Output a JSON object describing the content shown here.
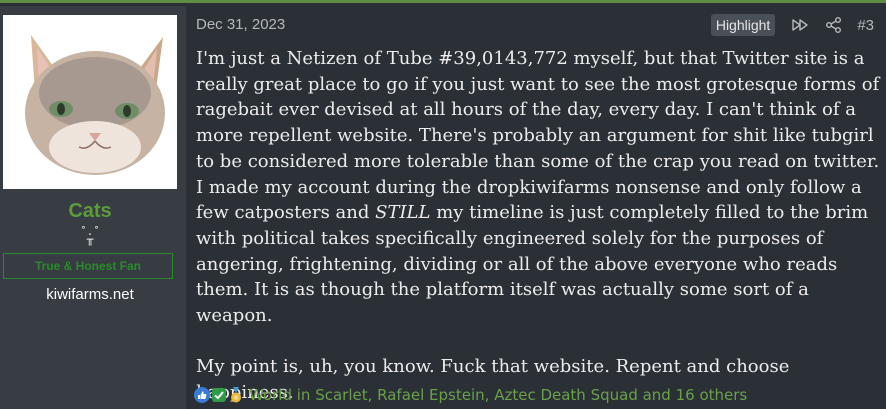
{
  "user": {
    "username": "Cats",
    "title": "˚.˚\n╥",
    "banner": "True & Honest Fan",
    "site": "kiwifarms.net"
  },
  "post": {
    "date": "Dec 31, 2023",
    "highlight_label": "Highlight",
    "number": "#3",
    "para1_a": "I'm just a Netizen of Tube #39,0143,772 myself, but that Twitter site is a really great place to go if you just want to see the most grotesque forms of ragebait ever devised at all hours of the day, every day. I can't think of a more repellent website. There's probably an argument for shit like tubgirl to be considered more tolerable than some of the crap you read on twitter. I made my account during the dropkiwifarms nonsense and only follow a few catposters and ",
    "para1_em": "STILL",
    "para1_b": " my timeline is just completely filled to the brim with political takes specifically engineered solely for the purposes of angering, frightening, dividing or all of the above everyone who reads them. It is as though the platform itself was actually some sort of a weapon.",
    "para2": "My point is, uh, you know. Fuck that website. Repent and choose happiness."
  },
  "reactions": {
    "icons": [
      "thumbs-up-icon",
      "check-icon",
      "medal-icon"
    ],
    "text": "World in Scarlet, Rafael Epstein, Aztec Death Squad and 16 others"
  },
  "colors": {
    "accent_green": "#5d9a3b",
    "background": "#2b3036",
    "user_panel": "#383d44"
  }
}
